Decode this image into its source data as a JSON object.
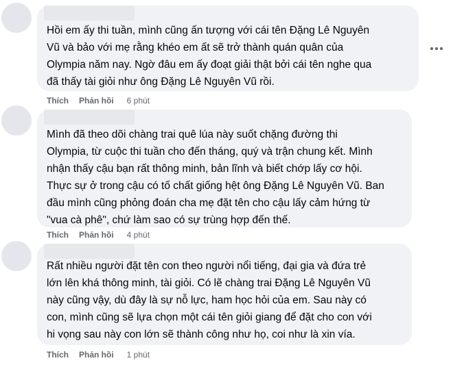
{
  "comments": [
    {
      "text": "Hồi em ấy thi tuần, mình cũng ấn tượng với cái tên Đặng Lê Nguyên\nVũ và bảo với mẹ rằng khéo em ất sẽ trở thành quán quân của\nOlympia năm nay. Ngờ đâu em ấy đoạt giải thật bởi cái tên nghe qua\nđã thấy tài giỏi như ông Đặng Lê Nguyên Vũ rồi.",
      "like": "Thích",
      "reply": "Phản hồi",
      "time": "6 phút"
    },
    {
      "text": "Mình đã theo dõi chàng trai quê lúa này suốt chặng đường thi\nOlympia, từ cuộc thi tuần cho đến tháng, quý và trận chung kết. Mình\nnhận thấy cậu bạn rất thông minh, bản lĩnh và biết chớp lấy cơ hội.\nThực sự ở trong cậu có tố chất giống hệt ông Đặng Lê Nguyên Vũ. Ban\nđầu mình cũng phỏng đoán cha mẹ đặt tên cho cậu lấy cảm hứng từ\n\"vua cà phê\", chứ làm sao có sự trùng hợp đến thế.",
      "like": "Thích",
      "reply": "Phản hồi",
      "time": "4 phút"
    },
    {
      "text": "Rất nhiều người đặt tên con theo người nổi tiếng, đại gia và đứa trẻ\nlớn lên khá thông minh, tài giỏi. Có lẽ chàng trai Đặng Lê Nguyên Vũ\nnày cũng vậy, dù đây là sự nỗ lực, ham học hỏi của em. Sau này có\ncon, mình cũng sẽ lựa chọn một cái tên giỏi giang để đặt cho con với\nhi vọng sau này con lớn sẽ thành công như họ, coi như là xin vía.",
      "like": "Thích",
      "reply": "Phản hồi",
      "time": "1 phút"
    }
  ],
  "icons": {
    "more": "more-options-icon"
  }
}
